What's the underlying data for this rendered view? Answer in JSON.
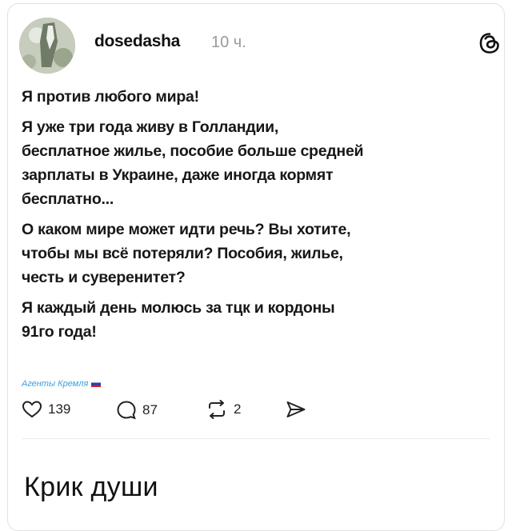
{
  "post": {
    "author": "dosedasha",
    "time": "10 ч.",
    "paragraphs": [
      "Я против любого мира!",
      "Я уже три года живу в Голландии,\nбесплатное жилье, пособие больше средней\nзарплаты в Украине, даже иногда кормят\nбесплатно...",
      "О каком мире может идти речь? Вы хотите,\nчтобы мы всё потеряли? Пособия, жилье,\nчесть и суверенитет?",
      "Я каждый день молюсь за тцк и кордоны\n91го года!"
    ],
    "watermark": "Агенты Кремля",
    "likes": "139",
    "comments": "87",
    "reposts": "2"
  },
  "caption": "Крик души",
  "icons": [
    "threads-logo-icon",
    "heart-icon",
    "comment-icon",
    "repost-icon",
    "send-icon"
  ],
  "colors": {
    "watermark": "#3aa0e0",
    "text": "#171717",
    "muted": "#9a9a9a"
  }
}
